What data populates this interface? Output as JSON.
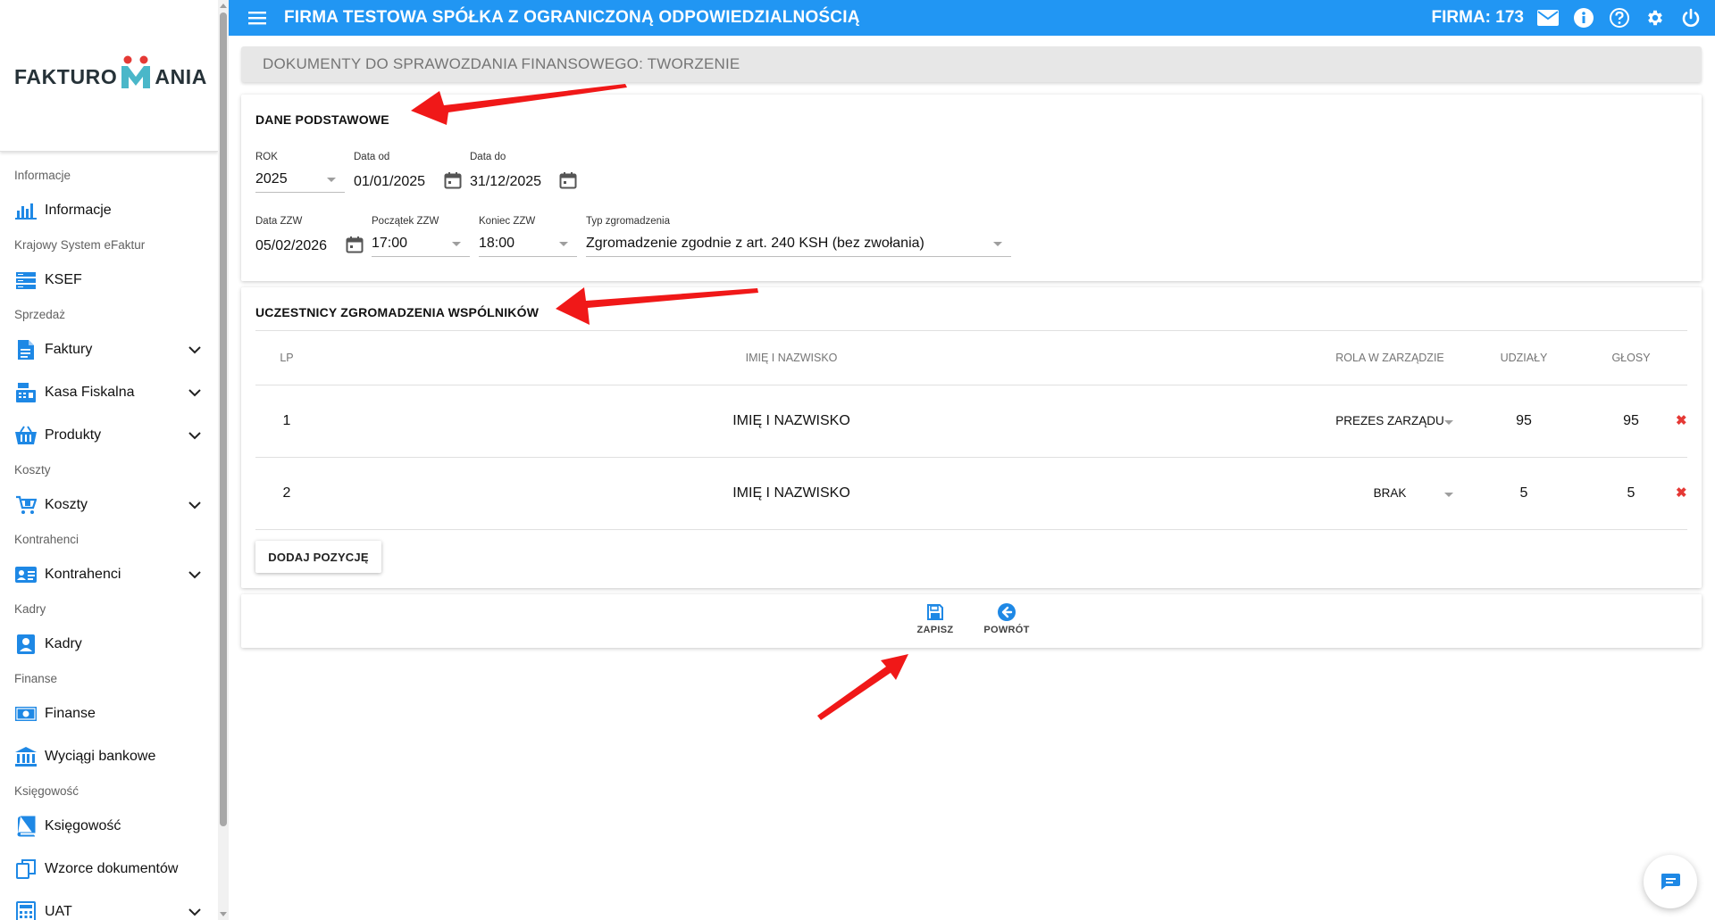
{
  "app": {
    "logo_text_left": "FAKTURO",
    "logo_text_right": "ANIA",
    "company_title": "FIRMA TESTOWA SPÓŁKA Z OGRANICZONĄ ODPOWIEDZIALNOŚCIĄ",
    "firma_label": "FIRMA: 173",
    "accent_color": "#2196f3",
    "top_icons": [
      "mail-icon",
      "info-icon",
      "help-icon",
      "gear-icon",
      "power-icon"
    ]
  },
  "sidebar": {
    "items": [
      {
        "type": "section",
        "label": "Informacje"
      },
      {
        "type": "item",
        "label": "Informacje",
        "icon": "bar-chart-icon",
        "expandable": false
      },
      {
        "type": "section",
        "label": "Krajowy System eFaktur"
      },
      {
        "type": "item",
        "label": "KSEF",
        "icon": "server-icon",
        "expandable": false
      },
      {
        "type": "section",
        "label": "Sprzedaż"
      },
      {
        "type": "item",
        "label": "Faktury",
        "icon": "document-icon",
        "expandable": true
      },
      {
        "type": "item",
        "label": "Kasa Fiskalna",
        "icon": "cash-register-icon",
        "expandable": true
      },
      {
        "type": "item",
        "label": "Produkty",
        "icon": "basket-icon",
        "expandable": true
      },
      {
        "type": "section",
        "label": "Koszty"
      },
      {
        "type": "item",
        "label": "Koszty",
        "icon": "cart-icon",
        "expandable": true
      },
      {
        "type": "section",
        "label": "Kontrahenci"
      },
      {
        "type": "item",
        "label": "Kontrahenci",
        "icon": "contact-card-icon",
        "expandable": true
      },
      {
        "type": "section",
        "label": "Kadry"
      },
      {
        "type": "item",
        "label": "Kadry",
        "icon": "person-badge-icon",
        "expandable": false
      },
      {
        "type": "section",
        "label": "Finanse"
      },
      {
        "type": "item",
        "label": "Finanse",
        "icon": "banknote-icon",
        "expandable": false
      },
      {
        "type": "item",
        "label": "Wyciągi bankowe",
        "icon": "bank-icon",
        "expandable": false
      },
      {
        "type": "section",
        "label": "Księgowość"
      },
      {
        "type": "item",
        "label": "Księgowość",
        "icon": "book-icon",
        "expandable": false
      },
      {
        "type": "item",
        "label": "Wzorce dokumentów",
        "icon": "copy-docs-icon",
        "expandable": false
      },
      {
        "type": "item",
        "label": "UAT",
        "icon": "calculator-icon",
        "expandable": true
      }
    ]
  },
  "page": {
    "title": "DOKUMENTY DO SPRAWOZDANIA FINANSOWEGO: TWORZENIE"
  },
  "basic": {
    "section_title": "DANE PODSTAWOWE",
    "rok": {
      "label": "ROK",
      "value": "2025"
    },
    "data_od": {
      "label": "Data od",
      "value": "01/01/2025"
    },
    "data_do": {
      "label": "Data do",
      "value": "31/12/2025"
    },
    "data_zzw": {
      "label": "Data ZZW",
      "value": "05/02/2026"
    },
    "poczatek_zzw": {
      "label": "Początek ZZW",
      "value": "17:00"
    },
    "koniec_zzw": {
      "label": "Koniec ZZW",
      "value": "18:00"
    },
    "typ_zgromadzenia": {
      "label": "Typ zgromadzenia",
      "value": "Zgromadzenie zgodnie z art. 240 KSH (bez zwołania)"
    }
  },
  "participants": {
    "section_title": "UCZESTNICY ZGROMADZENIA WSPÓLNIKÓW",
    "columns": [
      "LP",
      "IMIĘ I NAZWISKO",
      "ROLA W ZARZĄDZIE",
      "UDZIAŁY",
      "GŁOSY"
    ],
    "rows": [
      {
        "lp": "1",
        "name": "IMIĘ I NAZWISKO",
        "role": "PREZES ZARZĄDU",
        "shares": "95",
        "votes": "95",
        "delete": "✖"
      },
      {
        "lp": "2",
        "name": "IMIĘ I NAZWISKO",
        "role": "BRAK",
        "shares": "5",
        "votes": "5",
        "delete": "✖"
      }
    ],
    "add_button": "DODAJ POZYCJĘ"
  },
  "actions": {
    "save_label": "ZAPISZ",
    "back_label": "POWRÓT"
  },
  "annotation_color": "#f01818"
}
